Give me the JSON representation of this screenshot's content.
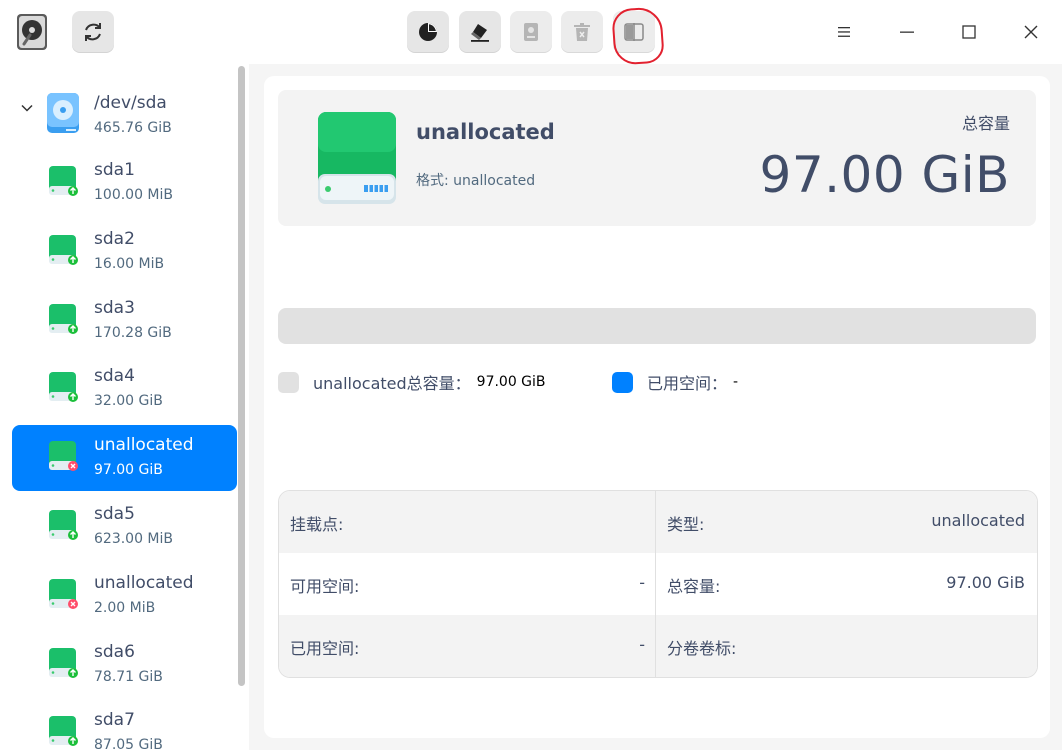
{
  "toolbar": {
    "buttons": [
      {
        "id": "partition",
        "icon": "pie-chart-icon",
        "enabled": true
      },
      {
        "id": "wipe",
        "icon": "eraser-icon",
        "enabled": true
      },
      {
        "id": "mount",
        "icon": "mount-disk-icon",
        "enabled": false
      },
      {
        "id": "delete",
        "icon": "trash-icon",
        "enabled": false
      },
      {
        "id": "resize",
        "icon": "resize-partition-icon",
        "enabled": false
      }
    ],
    "annotation_color": "#e2212f"
  },
  "colors": {
    "accent": "#0081ff",
    "drive_green": "#1bbf6a",
    "text": "#414d68"
  },
  "sidebar": {
    "disk": {
      "name": "/dev/sda",
      "size": "465.76 GiB",
      "expanded": true
    },
    "partitions": [
      {
        "name": "sda1",
        "size": "100.00 MiB",
        "status": "mounted"
      },
      {
        "name": "sda2",
        "size": "16.00 MiB",
        "status": "mounted"
      },
      {
        "name": "sda3",
        "size": "170.28 GiB",
        "status": "mounted"
      },
      {
        "name": "sda4",
        "size": "32.00 GiB",
        "status": "mounted"
      },
      {
        "name": "unallocated",
        "size": "97.00 GiB",
        "status": "unallocated",
        "selected": true
      },
      {
        "name": "sda5",
        "size": "623.00 MiB",
        "status": "mounted"
      },
      {
        "name": "unallocated",
        "size": "2.00 MiB",
        "status": "unallocated"
      },
      {
        "name": "sda6",
        "size": "78.71 GiB",
        "status": "mounted"
      },
      {
        "name": "sda7",
        "size": "87.05 GiB",
        "status": "mounted"
      }
    ]
  },
  "main": {
    "title": "unallocated",
    "format": "格式: unallocated",
    "total_label": "总容量",
    "total_value": "97.00 GiB",
    "usage_fraction": 0,
    "legend": {
      "total_label": "unallocated总容量：",
      "total_value": "97.00 GiB",
      "used_label": "已用空间：",
      "used_value": "-"
    },
    "info": {
      "mount_point_label": "挂载点:",
      "mount_point_value": "",
      "type_label": "类型:",
      "type_value": "unallocated",
      "free_label": "可用空间:",
      "free_value": "-",
      "capacity_label": "总容量:",
      "capacity_value": "97.00 GiB",
      "used_label": "已用空间:",
      "used_value": "-",
      "volume_label_label": "分卷卷标:",
      "volume_label_value": ""
    }
  }
}
